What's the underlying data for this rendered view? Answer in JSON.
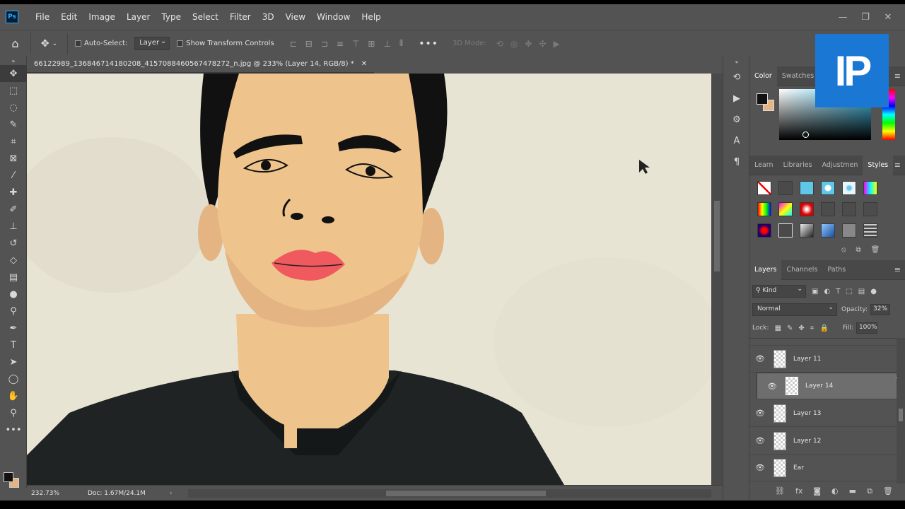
{
  "app": {
    "logo": "Ps"
  },
  "menu": [
    "File",
    "Edit",
    "Image",
    "Layer",
    "Type",
    "Select",
    "Filter",
    "3D",
    "View",
    "Window",
    "Help"
  ],
  "window_controls": [
    "—",
    "❐",
    "✕"
  ],
  "options": {
    "auto_select_label": "Auto-Select:",
    "auto_select_value": "Layer",
    "show_transform_label": "Show Transform Controls",
    "more_label": "•••",
    "mode_3d_label": "3D Mode:"
  },
  "document": {
    "tab_title": "66122989_136846714180208_4157088460567478272_n.jpg @ 233% (Layer 14, RGB/8) *",
    "close": "✕"
  },
  "status": {
    "zoom": "232.73%",
    "doc": "Doc: 1.67M/24.1M",
    "arrow": "›"
  },
  "color_panel": {
    "tabs": [
      "Color",
      "Swatches"
    ],
    "foreground": "#111111",
    "background": "#e4b583"
  },
  "brand": {
    "text": "IP"
  },
  "styles_panel": {
    "tabs": [
      "Learn",
      "Libraries",
      "Adjustmen",
      "Styles"
    ]
  },
  "layers_panel": {
    "tabs": [
      "Layers",
      "Channels",
      "Paths"
    ],
    "filter_kind": "Kind",
    "blend_mode": "Normal",
    "opacity_label": "Opacity:",
    "opacity": "32%",
    "lock_label": "Lock:",
    "fill_label": "Fill:",
    "fill": "100%",
    "layers": [
      {
        "name": "Layer 11",
        "selected": false
      },
      {
        "name": "Layer 14",
        "selected": true
      },
      {
        "name": "Layer 13",
        "selected": false
      },
      {
        "name": "Layer 12",
        "selected": false
      },
      {
        "name": "Ear",
        "selected": false
      }
    ]
  },
  "colors": {
    "ui_bg": "#535353",
    "canvas_bg": "#e8e4d4",
    "skin": "#eec48c",
    "skin_shadow": "#e4b583",
    "hair": "#111111",
    "shirt": "#1f2324",
    "lips": "#f05a5f",
    "accent": "#1a77d4"
  }
}
